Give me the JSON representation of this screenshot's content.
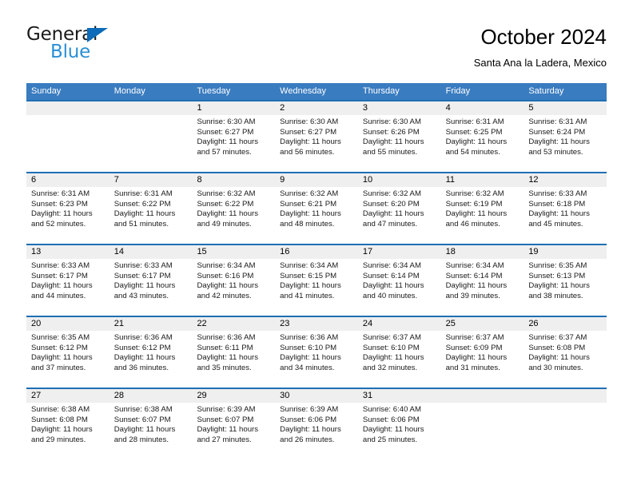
{
  "brand": {
    "line1": "General",
    "line2": "Blue",
    "triangle_icon": "brand-triangle-icon",
    "color_dark": "#1a1a1a",
    "color_blue": "#2a8fd6",
    "triangle_color": "#0d6cb9"
  },
  "header": {
    "title": "October 2024",
    "subtitle": "Santa Ana la Ladera, Mexico"
  },
  "theme": {
    "header_blue": "#3a7cc0",
    "separator_blue": "#1f6fb5",
    "daynum_band": "#efefef",
    "body_white": "#ffffff"
  },
  "weekdays": [
    "Sunday",
    "Monday",
    "Tuesday",
    "Wednesday",
    "Thursday",
    "Friday",
    "Saturday"
  ],
  "weeks": [
    [
      {
        "day": "",
        "lines": []
      },
      {
        "day": "",
        "lines": []
      },
      {
        "day": "1",
        "lines": [
          "Sunrise: 6:30 AM",
          "Sunset: 6:27 PM",
          "Daylight: 11 hours",
          "and 57 minutes."
        ]
      },
      {
        "day": "2",
        "lines": [
          "Sunrise: 6:30 AM",
          "Sunset: 6:27 PM",
          "Daylight: 11 hours",
          "and 56 minutes."
        ]
      },
      {
        "day": "3",
        "lines": [
          "Sunrise: 6:30 AM",
          "Sunset: 6:26 PM",
          "Daylight: 11 hours",
          "and 55 minutes."
        ]
      },
      {
        "day": "4",
        "lines": [
          "Sunrise: 6:31 AM",
          "Sunset: 6:25 PM",
          "Daylight: 11 hours",
          "and 54 minutes."
        ]
      },
      {
        "day": "5",
        "lines": [
          "Sunrise: 6:31 AM",
          "Sunset: 6:24 PM",
          "Daylight: 11 hours",
          "and 53 minutes."
        ]
      }
    ],
    [
      {
        "day": "6",
        "lines": [
          "Sunrise: 6:31 AM",
          "Sunset: 6:23 PM",
          "Daylight: 11 hours",
          "and 52 minutes."
        ]
      },
      {
        "day": "7",
        "lines": [
          "Sunrise: 6:31 AM",
          "Sunset: 6:22 PM",
          "Daylight: 11 hours",
          "and 51 minutes."
        ]
      },
      {
        "day": "8",
        "lines": [
          "Sunrise: 6:32 AM",
          "Sunset: 6:22 PM",
          "Daylight: 11 hours",
          "and 49 minutes."
        ]
      },
      {
        "day": "9",
        "lines": [
          "Sunrise: 6:32 AM",
          "Sunset: 6:21 PM",
          "Daylight: 11 hours",
          "and 48 minutes."
        ]
      },
      {
        "day": "10",
        "lines": [
          "Sunrise: 6:32 AM",
          "Sunset: 6:20 PM",
          "Daylight: 11 hours",
          "and 47 minutes."
        ]
      },
      {
        "day": "11",
        "lines": [
          "Sunrise: 6:32 AM",
          "Sunset: 6:19 PM",
          "Daylight: 11 hours",
          "and 46 minutes."
        ]
      },
      {
        "day": "12",
        "lines": [
          "Sunrise: 6:33 AM",
          "Sunset: 6:18 PM",
          "Daylight: 11 hours",
          "and 45 minutes."
        ]
      }
    ],
    [
      {
        "day": "13",
        "lines": [
          "Sunrise: 6:33 AM",
          "Sunset: 6:17 PM",
          "Daylight: 11 hours",
          "and 44 minutes."
        ]
      },
      {
        "day": "14",
        "lines": [
          "Sunrise: 6:33 AM",
          "Sunset: 6:17 PM",
          "Daylight: 11 hours",
          "and 43 minutes."
        ]
      },
      {
        "day": "15",
        "lines": [
          "Sunrise: 6:34 AM",
          "Sunset: 6:16 PM",
          "Daylight: 11 hours",
          "and 42 minutes."
        ]
      },
      {
        "day": "16",
        "lines": [
          "Sunrise: 6:34 AM",
          "Sunset: 6:15 PM",
          "Daylight: 11 hours",
          "and 41 minutes."
        ]
      },
      {
        "day": "17",
        "lines": [
          "Sunrise: 6:34 AM",
          "Sunset: 6:14 PM",
          "Daylight: 11 hours",
          "and 40 minutes."
        ]
      },
      {
        "day": "18",
        "lines": [
          "Sunrise: 6:34 AM",
          "Sunset: 6:14 PM",
          "Daylight: 11 hours",
          "and 39 minutes."
        ]
      },
      {
        "day": "19",
        "lines": [
          "Sunrise: 6:35 AM",
          "Sunset: 6:13 PM",
          "Daylight: 11 hours",
          "and 38 minutes."
        ]
      }
    ],
    [
      {
        "day": "20",
        "lines": [
          "Sunrise: 6:35 AM",
          "Sunset: 6:12 PM",
          "Daylight: 11 hours",
          "and 37 minutes."
        ]
      },
      {
        "day": "21",
        "lines": [
          "Sunrise: 6:36 AM",
          "Sunset: 6:12 PM",
          "Daylight: 11 hours",
          "and 36 minutes."
        ]
      },
      {
        "day": "22",
        "lines": [
          "Sunrise: 6:36 AM",
          "Sunset: 6:11 PM",
          "Daylight: 11 hours",
          "and 35 minutes."
        ]
      },
      {
        "day": "23",
        "lines": [
          "Sunrise: 6:36 AM",
          "Sunset: 6:10 PM",
          "Daylight: 11 hours",
          "and 34 minutes."
        ]
      },
      {
        "day": "24",
        "lines": [
          "Sunrise: 6:37 AM",
          "Sunset: 6:10 PM",
          "Daylight: 11 hours",
          "and 32 minutes."
        ]
      },
      {
        "day": "25",
        "lines": [
          "Sunrise: 6:37 AM",
          "Sunset: 6:09 PM",
          "Daylight: 11 hours",
          "and 31 minutes."
        ]
      },
      {
        "day": "26",
        "lines": [
          "Sunrise: 6:37 AM",
          "Sunset: 6:08 PM",
          "Daylight: 11 hours",
          "and 30 minutes."
        ]
      }
    ],
    [
      {
        "day": "27",
        "lines": [
          "Sunrise: 6:38 AM",
          "Sunset: 6:08 PM",
          "Daylight: 11 hours",
          "and 29 minutes."
        ]
      },
      {
        "day": "28",
        "lines": [
          "Sunrise: 6:38 AM",
          "Sunset: 6:07 PM",
          "Daylight: 11 hours",
          "and 28 minutes."
        ]
      },
      {
        "day": "29",
        "lines": [
          "Sunrise: 6:39 AM",
          "Sunset: 6:07 PM",
          "Daylight: 11 hours",
          "and 27 minutes."
        ]
      },
      {
        "day": "30",
        "lines": [
          "Sunrise: 6:39 AM",
          "Sunset: 6:06 PM",
          "Daylight: 11 hours",
          "and 26 minutes."
        ]
      },
      {
        "day": "31",
        "lines": [
          "Sunrise: 6:40 AM",
          "Sunset: 6:06 PM",
          "Daylight: 11 hours",
          "and 25 minutes."
        ]
      },
      {
        "day": "",
        "lines": []
      },
      {
        "day": "",
        "lines": []
      }
    ]
  ]
}
